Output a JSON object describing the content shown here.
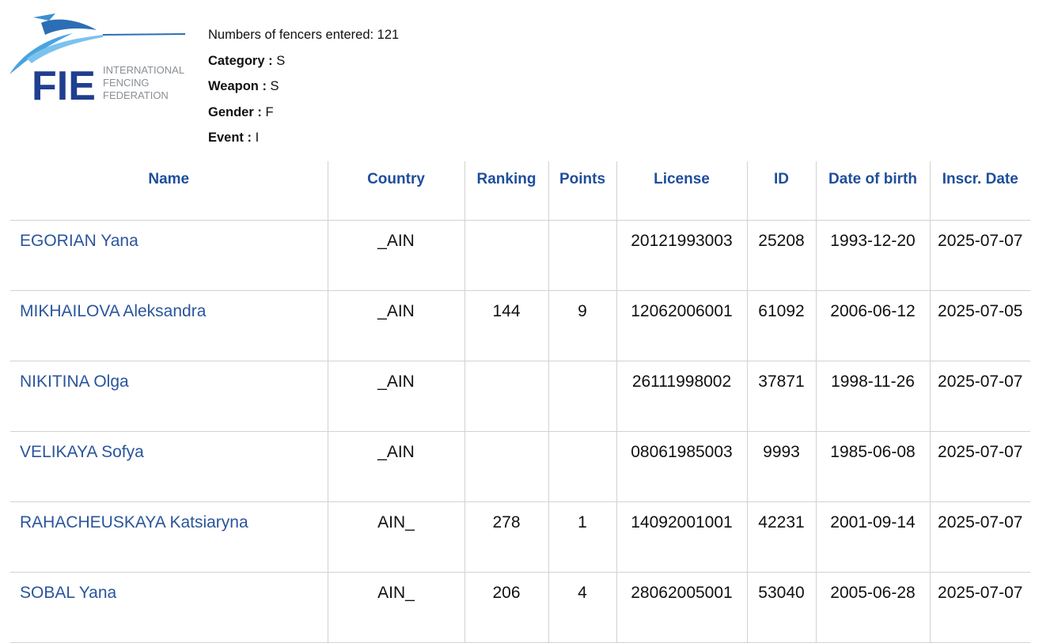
{
  "logo": {
    "acronym": "FIE",
    "line1": "INTERNATIONAL",
    "line2": "FENCING",
    "line3": "FEDERATION"
  },
  "info": {
    "fencers_entered": "Numbers of fencers entered: 121",
    "category_label": "Category :",
    "category_value": "S",
    "weapon_label": "Weapon :",
    "weapon_value": "S",
    "gender_label": "Gender :",
    "gender_value": "F",
    "event_label": "Event :",
    "event_value": "I"
  },
  "table": {
    "headers": [
      "Name",
      "Country",
      "Ranking",
      "Points",
      "License",
      "ID",
      "Date of birth",
      "Inscr. Date"
    ],
    "rows": [
      {
        "name": "EGORIAN Yana",
        "country": "_AIN",
        "ranking": "",
        "points": "",
        "license": "20121993003",
        "id": "25208",
        "dob": "1993-12-20",
        "inscr": "2025-07-07"
      },
      {
        "name": "MIKHAILOVA Aleksandra",
        "country": "_AIN",
        "ranking": "144",
        "points": "9",
        "license": "12062006001",
        "id": "61092",
        "dob": "2006-06-12",
        "inscr": "2025-07-05"
      },
      {
        "name": "NIKITINA Olga",
        "country": "_AIN",
        "ranking": "",
        "points": "",
        "license": "26111998002",
        "id": "37871",
        "dob": "1998-11-26",
        "inscr": "2025-07-07"
      },
      {
        "name": "VELIKAYA Sofya",
        "country": "_AIN",
        "ranking": "",
        "points": "",
        "license": "08061985003",
        "id": "9993",
        "dob": "1985-06-08",
        "inscr": "2025-07-07"
      },
      {
        "name": "RAHACHEUSKAYA Katsiaryna",
        "country": "AIN_",
        "ranking": "278",
        "points": "1",
        "license": "14092001001",
        "id": "42231",
        "dob": "2001-09-14",
        "inscr": "2025-07-07"
      },
      {
        "name": "SOBAL Yana",
        "country": "AIN_",
        "ranking": "206",
        "points": "4",
        "license": "28062005001",
        "id": "53040",
        "dob": "2005-06-28",
        "inscr": "2025-07-07"
      }
    ]
  }
}
